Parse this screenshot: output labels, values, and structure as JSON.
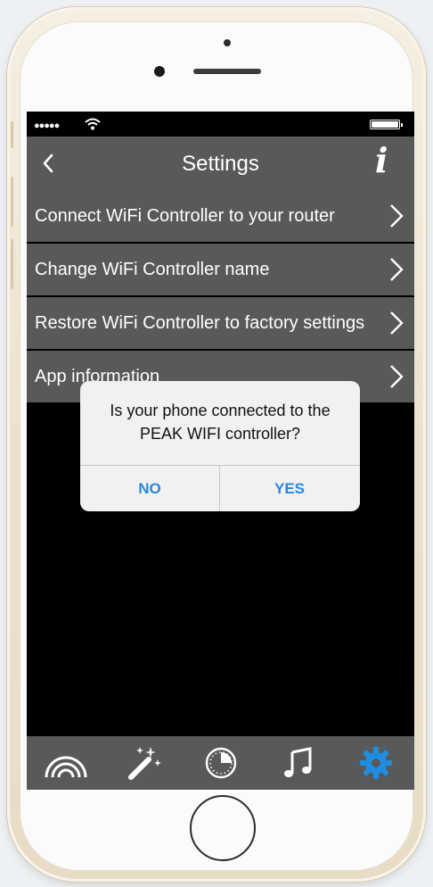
{
  "status_bar": {
    "signal": "●●●●●"
  },
  "nav": {
    "title": "Settings",
    "info_label": "i"
  },
  "menu": {
    "items": [
      {
        "label": "Connect WiFi Controller to your router"
      },
      {
        "label": "Change WiFi Controller name"
      },
      {
        "label": "Restore WiFi Controller to factory settings"
      },
      {
        "label": "App information"
      }
    ]
  },
  "alert": {
    "message": "Is your phone connected to the PEAK WIFI controller?",
    "no_label": "NO",
    "yes_label": "YES"
  },
  "tabs": [
    {
      "icon": "rainbow-icon",
      "active": false
    },
    {
      "icon": "magic-wand-icon",
      "active": false
    },
    {
      "icon": "timer-icon",
      "active": false
    },
    {
      "icon": "music-note-icon",
      "active": false
    },
    {
      "icon": "gear-icon",
      "active": true
    }
  ],
  "colors": {
    "bar_bg": "#58595b",
    "active_tab": "#1e8fe0",
    "alert_button": "#2a86e0"
  }
}
